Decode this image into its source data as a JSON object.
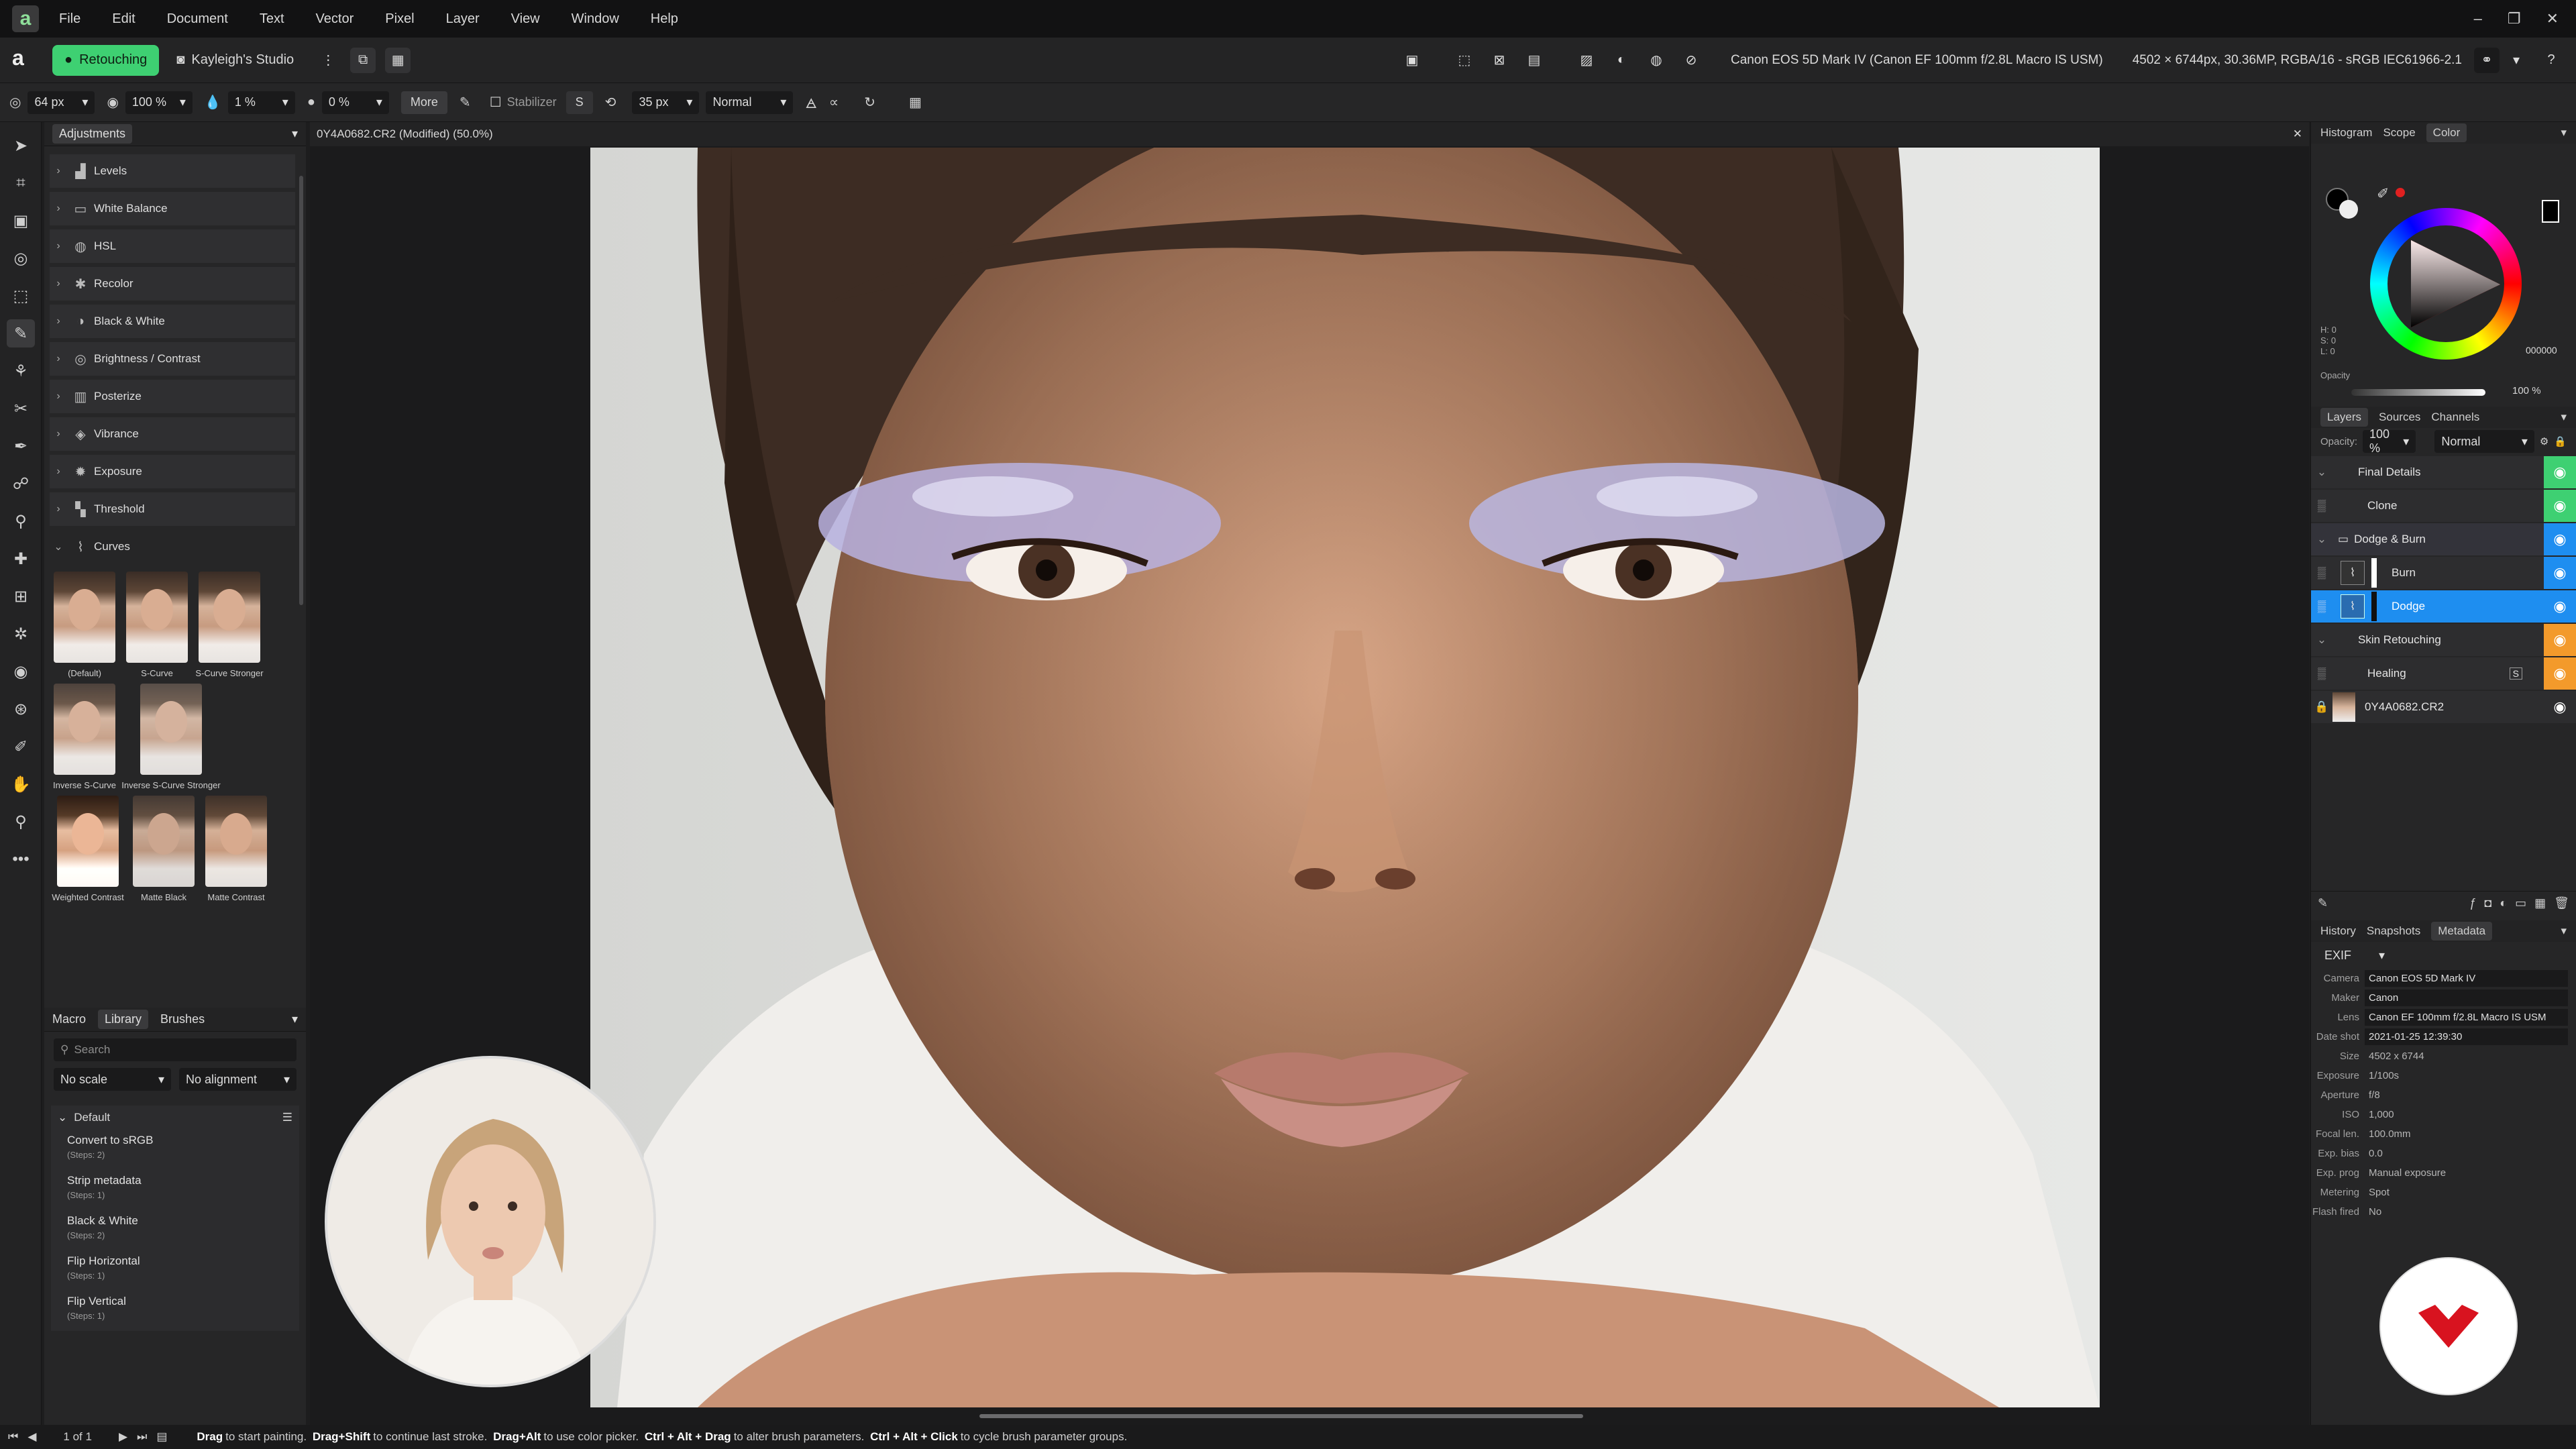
{
  "menu": [
    "File",
    "Edit",
    "Document",
    "Text",
    "Vector",
    "Pixel",
    "Layer",
    "View",
    "Window",
    "Help"
  ],
  "toolbar": {
    "studio_active": "Retouching",
    "studio_other": "Kayleigh's Studio",
    "camera_info": "Canon EOS 5D Mark IV (Canon EF 100mm f/2.8L Macro IS USM)",
    "image_info": "4502 × 6744px, 30.36MP, RGBA/16 - sRGB IEC61966-2.1"
  },
  "context": {
    "width": "64 px",
    "opacity": "100 %",
    "flow": "1 %",
    "hardness": "0 %",
    "more": "More",
    "stabilizer": "Stabilizer",
    "brush_size": "35 px",
    "blend": "Normal"
  },
  "adjustments": {
    "title": "Adjustments",
    "items": [
      "Levels",
      "White Balance",
      "HSL",
      "Recolor",
      "Black & White",
      "Brightness / Contrast",
      "Posterize",
      "Vibrance",
      "Exposure",
      "Threshold",
      "Curves"
    ],
    "presets": [
      "(Default)",
      "S-Curve",
      "S-Curve Stronger",
      "Inverse S-Curve",
      "Inverse S-Curve Stronger",
      "Weighted Contrast",
      "Matte Black",
      "Matte Contrast"
    ]
  },
  "library": {
    "tabs": [
      "Macro",
      "Library",
      "Brushes"
    ],
    "search_placeholder": "Search",
    "scale": "No scale",
    "alignment": "No alignment",
    "group": "Default",
    "items": [
      {
        "name": "Convert to sRGB",
        "steps": "(Steps: 2)"
      },
      {
        "name": "Strip metadata",
        "steps": "(Steps: 1)"
      },
      {
        "name": "Black & White",
        "steps": "(Steps: 2)"
      },
      {
        "name": "Flip Horizontal",
        "steps": "(Steps: 1)"
      },
      {
        "name": "Flip Vertical",
        "steps": "(Steps: 1)"
      }
    ]
  },
  "document": {
    "tab": "0Y4A0682.CR2 (Modified) (50.0%)"
  },
  "color": {
    "tabs": [
      "Histogram",
      "Scope",
      "Color"
    ],
    "h": "H: 0",
    "s": "S: 0",
    "l": "L: 0",
    "hex": "000000",
    "opacity_label": "Opacity",
    "opacity": "100 %"
  },
  "layers": {
    "tabs": [
      "Layers",
      "Sources",
      "Channels"
    ],
    "opacity_label": "Opacity:",
    "opacity": "100 %",
    "blend": "Normal",
    "items": [
      {
        "name": "Final Details",
        "color": "#3ed072"
      },
      {
        "name": "Clone",
        "color": "#3ed072"
      },
      {
        "name": "Dodge & Burn",
        "color": "#1e8ef0"
      },
      {
        "name": "Burn",
        "color": "#1e8ef0"
      },
      {
        "name": "Dodge",
        "color": "#1e8ef0"
      },
      {
        "name": "Skin Retouching",
        "color": "#f39a2b"
      },
      {
        "name": "Healing",
        "color": "#f39a2b"
      },
      {
        "name": "0Y4A0682.CR2",
        "color": "#2d2d2f"
      }
    ]
  },
  "metadata": {
    "tabs": [
      "History",
      "Snapshots",
      "Metadata"
    ],
    "section": "EXIF",
    "fields": [
      {
        "k": "Camera",
        "v": "Canon EOS 5D Mark IV"
      },
      {
        "k": "Maker",
        "v": "Canon"
      },
      {
        "k": "Lens",
        "v": "Canon EF 100mm f/2.8L Macro IS USM"
      },
      {
        "k": "Date shot",
        "v": "2021-01-25 12:39:30"
      },
      {
        "k": "Size",
        "v": "4502 x 6744"
      },
      {
        "k": "Exposure",
        "v": "1/100s"
      },
      {
        "k": "Aperture",
        "v": "f/8"
      },
      {
        "k": "ISO",
        "v": "1,000"
      },
      {
        "k": "Focal len.",
        "v": "100.0mm"
      },
      {
        "k": "Exp. bias",
        "v": "0.0"
      },
      {
        "k": "Exp. prog",
        "v": "Manual exposure"
      },
      {
        "k": "Metering",
        "v": "Spot"
      },
      {
        "k": "Flash fired",
        "v": "No"
      }
    ]
  },
  "status": {
    "page": "1 of 1",
    "hint_parts": [
      "Drag",
      "to start painting.",
      "Drag+Shift",
      "to continue last stroke.",
      "Drag+Alt",
      "to use color picker.",
      "Ctrl + Alt + Drag",
      "to alter brush parameters.",
      "Ctrl + Alt + Click",
      "to cycle brush parameter groups."
    ]
  }
}
